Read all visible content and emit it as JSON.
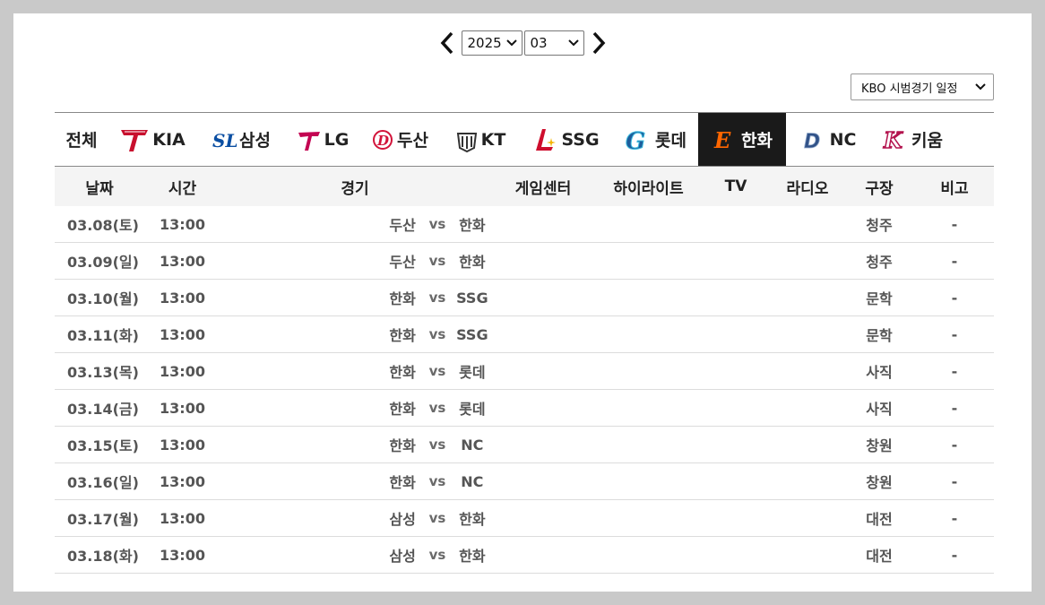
{
  "nav": {
    "year": "2025",
    "month": "03",
    "prev_icon": "chevron-left-icon",
    "next_icon": "chevron-right-icon"
  },
  "schedule_type": "KBO 시범경기 일정",
  "teams": [
    {
      "label": "전체",
      "logo": "none",
      "color": ""
    },
    {
      "label": "KIA",
      "logo": "kia-logo-icon",
      "color": "#c8102e"
    },
    {
      "label": "삼성",
      "logo": "samsung-logo-icon",
      "color": "#0a4ea2"
    },
    {
      "label": "LG",
      "logo": "lg-logo-icon",
      "color": "#c30452"
    },
    {
      "label": "두산",
      "logo": "doosan-logo-icon",
      "color": "#d2143a"
    },
    {
      "label": "KT",
      "logo": "kt-logo-icon",
      "color": "#333333"
    },
    {
      "label": "SSG",
      "logo": "ssg-logo-icon",
      "color": "#ce0e2d"
    },
    {
      "label": "롯데",
      "logo": "lotte-logo-icon",
      "color": "#1d5d9b"
    },
    {
      "label": "한화",
      "logo": "hanwha-logo-icon",
      "color": "#ff6600",
      "active": true
    },
    {
      "label": "NC",
      "logo": "nc-logo-icon",
      "color": "#315288"
    },
    {
      "label": "키움",
      "logo": "kiwoom-logo-icon",
      "color": "#820024"
    }
  ],
  "columns": [
    "날짜",
    "시간",
    "경기",
    "게임센터",
    "하이라이트",
    "TV",
    "라디오",
    "구장",
    "비고"
  ],
  "games": [
    {
      "date": "03.08(토)",
      "time": "13:00",
      "away": "두산",
      "vs": "vs",
      "home": "한화",
      "stadium": "청주",
      "note": "-"
    },
    {
      "date": "03.09(일)",
      "time": "13:00",
      "away": "두산",
      "vs": "vs",
      "home": "한화",
      "stadium": "청주",
      "note": "-"
    },
    {
      "date": "03.10(월)",
      "time": "13:00",
      "away": "한화",
      "vs": "vs",
      "home": "SSG",
      "stadium": "문학",
      "note": "-"
    },
    {
      "date": "03.11(화)",
      "time": "13:00",
      "away": "한화",
      "vs": "vs",
      "home": "SSG",
      "stadium": "문학",
      "note": "-"
    },
    {
      "date": "03.13(목)",
      "time": "13:00",
      "away": "한화",
      "vs": "vs",
      "home": "롯데",
      "stadium": "사직",
      "note": "-"
    },
    {
      "date": "03.14(금)",
      "time": "13:00",
      "away": "한화",
      "vs": "vs",
      "home": "롯데",
      "stadium": "사직",
      "note": "-"
    },
    {
      "date": "03.15(토)",
      "time": "13:00",
      "away": "한화",
      "vs": "vs",
      "home": "NC",
      "stadium": "창원",
      "note": "-"
    },
    {
      "date": "03.16(일)",
      "time": "13:00",
      "away": "한화",
      "vs": "vs",
      "home": "NC",
      "stadium": "창원",
      "note": "-"
    },
    {
      "date": "03.17(월)",
      "time": "13:00",
      "away": "삼성",
      "vs": "vs",
      "home": "한화",
      "stadium": "대전",
      "note": "-"
    },
    {
      "date": "03.18(화)",
      "time": "13:00",
      "away": "삼성",
      "vs": "vs",
      "home": "한화",
      "stadium": "대전",
      "note": "-"
    }
  ]
}
